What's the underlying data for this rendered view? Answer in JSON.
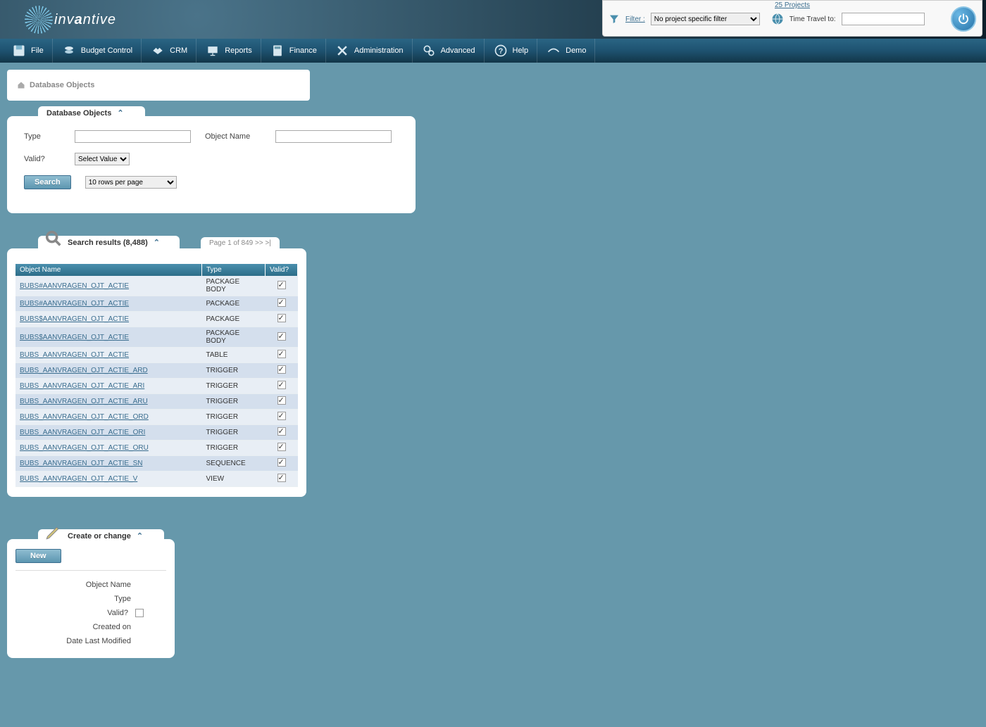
{
  "brand": {
    "name_pre": "inv",
    "name_post": "ntive"
  },
  "header": {
    "projects_count": "25 Projects",
    "filter_label": "Filter :",
    "filter_selected": "No project specific filter",
    "timetravel_label": "Time Travel to:",
    "timetravel_value": ""
  },
  "menu": [
    {
      "label": "File",
      "icon": "disk"
    },
    {
      "label": "Budget Control",
      "icon": "coins"
    },
    {
      "label": "CRM",
      "icon": "handshake"
    },
    {
      "label": "Reports",
      "icon": "board"
    },
    {
      "label": "Finance",
      "icon": "calc"
    },
    {
      "label": "Administration",
      "icon": "tools"
    },
    {
      "label": "Advanced",
      "icon": "gears"
    },
    {
      "label": "Help",
      "icon": "help"
    },
    {
      "label": "Demo",
      "icon": "swoosh"
    }
  ],
  "breadcrumb": "Database Objects",
  "search_panel": {
    "title": "Database Objects",
    "labels": {
      "type": "Type",
      "object_name": "Object Name",
      "valid": "Valid?"
    },
    "valid_placeholder": "Select Value",
    "search_btn": "Search",
    "rows_per_page": "10 rows per page"
  },
  "results": {
    "title": "Search results (8,488)",
    "pager": "Page 1 of 849  >>  >|",
    "columns": [
      "Object Name",
      "Type",
      "Valid?"
    ],
    "rows": [
      {
        "name": "BUBS#AANVRAGEN_OJT_ACTIE",
        "type": "PACKAGE BODY",
        "valid": true
      },
      {
        "name": "BUBS#AANVRAGEN_OJT_ACTIE",
        "type": "PACKAGE",
        "valid": true
      },
      {
        "name": "BUBS$AANVRAGEN_OJT_ACTIE",
        "type": "PACKAGE",
        "valid": true
      },
      {
        "name": "BUBS$AANVRAGEN_OJT_ACTIE",
        "type": "PACKAGE BODY",
        "valid": true
      },
      {
        "name": "BUBS_AANVRAGEN_OJT_ACTIE",
        "type": "TABLE",
        "valid": true
      },
      {
        "name": "BUBS_AANVRAGEN_OJT_ACTIE_ARD",
        "type": "TRIGGER",
        "valid": true
      },
      {
        "name": "BUBS_AANVRAGEN_OJT_ACTIE_ARI",
        "type": "TRIGGER",
        "valid": true
      },
      {
        "name": "BUBS_AANVRAGEN_OJT_ACTIE_ARU",
        "type": "TRIGGER",
        "valid": true
      },
      {
        "name": "BUBS_AANVRAGEN_OJT_ACTIE_ORD",
        "type": "TRIGGER",
        "valid": true
      },
      {
        "name": "BUBS_AANVRAGEN_OJT_ACTIE_ORI",
        "type": "TRIGGER",
        "valid": true
      },
      {
        "name": "BUBS_AANVRAGEN_OJT_ACTIE_ORU",
        "type": "TRIGGER",
        "valid": true
      },
      {
        "name": "BUBS_AANVRAGEN_OJT_ACTIE_SN",
        "type": "SEQUENCE",
        "valid": true
      },
      {
        "name": "BUBS_AANVRAGEN_OJT_ACTIE_V",
        "type": "VIEW",
        "valid": true
      }
    ]
  },
  "create": {
    "title": "Create or change",
    "new_btn": "New",
    "labels": {
      "object_name": "Object Name",
      "type": "Type",
      "valid": "Valid?",
      "created": "Created on",
      "modified": "Date Last Modified"
    }
  }
}
